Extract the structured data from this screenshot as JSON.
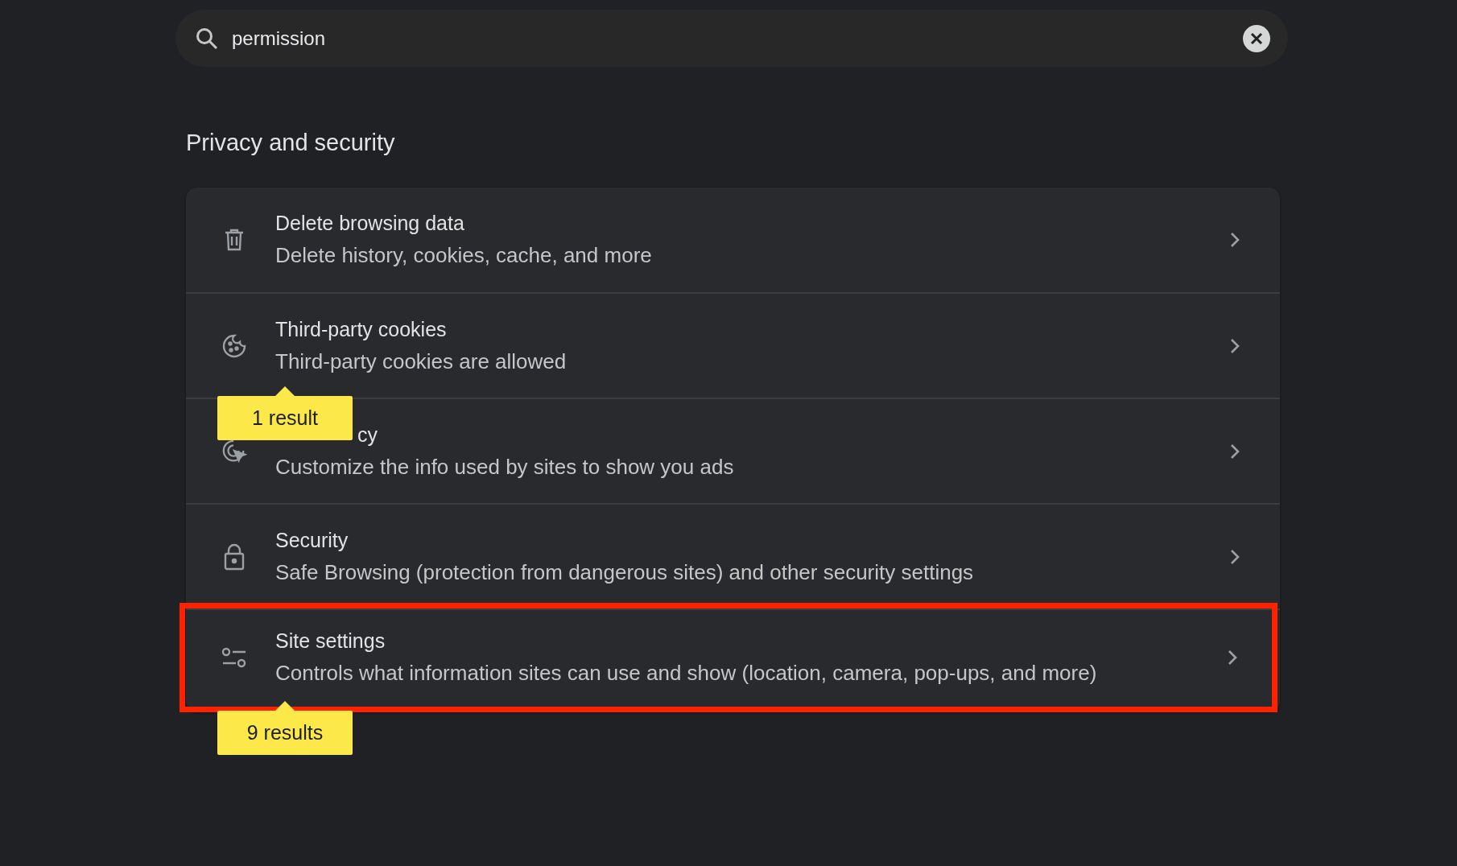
{
  "search": {
    "value": "permission"
  },
  "section": {
    "title": "Privacy and security"
  },
  "rows": [
    {
      "kind": "trash",
      "title": "Delete browsing data",
      "subtitle": "Delete history, cookies, cache, and more",
      "highlighted": false
    },
    {
      "kind": "cookie",
      "title": "Third-party cookies",
      "subtitle": "Third-party cookies are allowed",
      "highlighted": false,
      "badge": "1 result"
    },
    {
      "kind": "ads",
      "title": "cy",
      "title_covered": true,
      "subtitle": "Customize the info used by sites to show you ads",
      "highlighted": false
    },
    {
      "kind": "lock",
      "title": "Security",
      "subtitle": "Safe Browsing (protection from dangerous sites) and other security settings",
      "highlighted": false
    },
    {
      "kind": "sliders",
      "title": "Site settings",
      "subtitle": "Controls what information sites can use and show (location, camera, pop-ups, and more)",
      "highlighted": true,
      "badge": "9 results"
    }
  ]
}
